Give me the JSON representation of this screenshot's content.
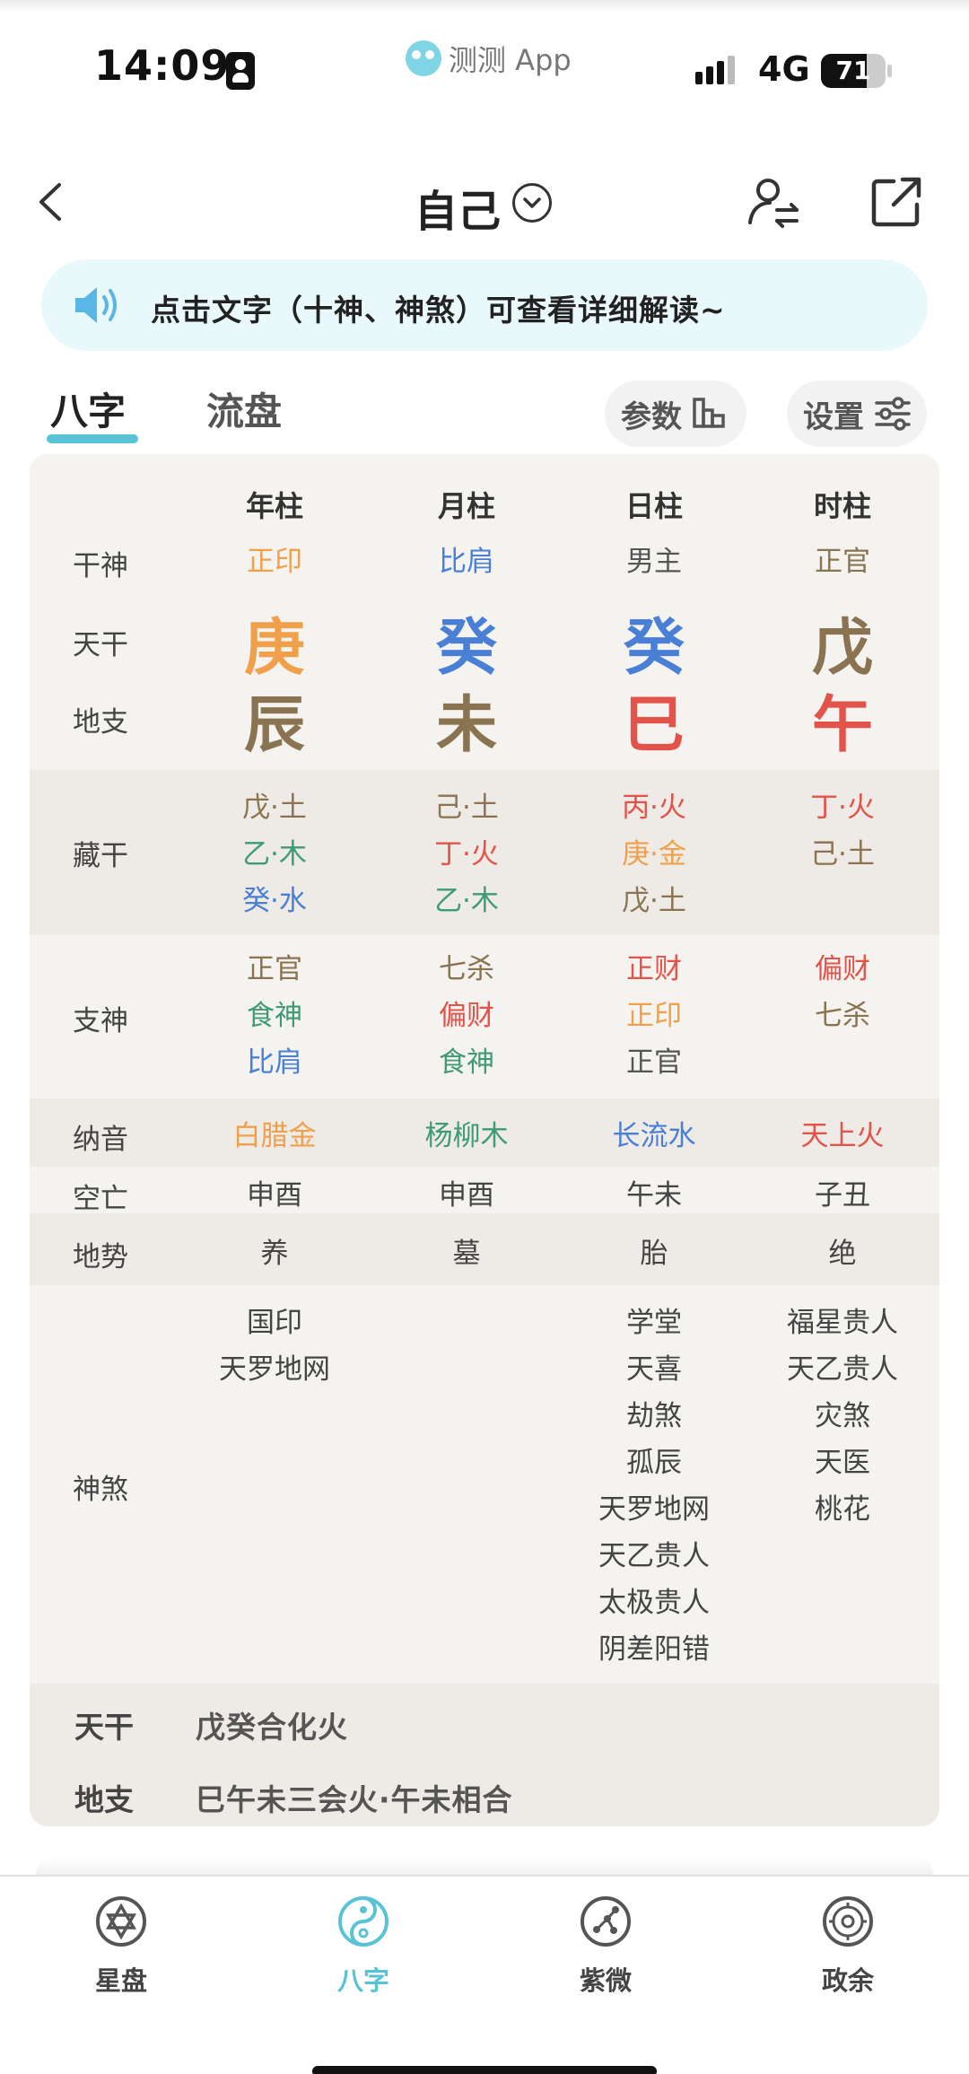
{
  "status_bar": {
    "time": "14:09",
    "app_label": "测测 App",
    "network": "4G",
    "battery": "71",
    "battery_level": 0.71
  },
  "header": {
    "title": "自己"
  },
  "tip": "点击文字（十神、神煞）可查看详细解读~",
  "tabs": [
    {
      "label": "八字",
      "active": true
    },
    {
      "label": "流盘",
      "active": false
    }
  ],
  "actions": {
    "params_label": "参数",
    "settings_label": "设置"
  },
  "colors": {
    "brown": "#8a7350",
    "orange": "#f0a04a",
    "blue": "#4a7fd6",
    "green": "#3e9b74",
    "red": "#e2534a",
    "gray": "#555555",
    "accent": "#59c3d6"
  },
  "chart": {
    "row_labels": {
      "shishen": "干神",
      "tiangan": "天干",
      "dizhi": "地支",
      "canggan": "藏干",
      "zhishen": "支神",
      "nayin": "纳音",
      "kongwang": "空亡",
      "dishi": "地势",
      "shensha": "神煞"
    },
    "columns": [
      {
        "header": "年柱",
        "shishen": "正印",
        "tiangan": "庚",
        "dizhi": "辰",
        "canggan": [
          "戊·土",
          "乙·木",
          "癸·水"
        ],
        "zhishen": [
          "正官",
          "食神",
          "比肩"
        ],
        "nayin": "白腊金",
        "kongwang": "申酉",
        "dishi": "养",
        "shensha": [
          "国印",
          "天罗地网"
        ]
      },
      {
        "header": "月柱",
        "shishen": "比肩",
        "tiangan": "癸",
        "dizhi": "未",
        "canggan": [
          "己·土",
          "丁·火",
          "乙·木"
        ],
        "zhishen": [
          "七杀",
          "偏财",
          "食神"
        ],
        "nayin": "杨柳木",
        "kongwang": "申酉",
        "dishi": "墓",
        "shensha": []
      },
      {
        "header": "日柱",
        "shishen": "男主",
        "tiangan": "癸",
        "dizhi": "巳",
        "canggan": [
          "丙·火",
          "庚·金",
          "戊·土"
        ],
        "zhishen": [
          "正财",
          "正印",
          "正官"
        ],
        "nayin": "长流水",
        "kongwang": "午未",
        "dishi": "胎",
        "shensha": [
          "学堂",
          "天喜",
          "劫煞",
          "孤辰",
          "天罗地网",
          "天乙贵人",
          "太极贵人",
          "阴差阳错"
        ]
      },
      {
        "header": "时柱",
        "shishen": "正官",
        "tiangan": "戊",
        "dizhi": "午",
        "canggan": [
          "丁·火",
          "己·土"
        ],
        "zhishen": [
          "偏财",
          "七杀"
        ],
        "nayin": "天上火",
        "kongwang": "子丑",
        "dishi": "绝",
        "shensha": [
          "福星贵人",
          "天乙贵人",
          "灾煞",
          "天医",
          "桃花"
        ]
      }
    ]
  },
  "summary": {
    "tiangan_label": "天干",
    "tiangan_value": "戊癸合化火",
    "dizhi_label": "地支",
    "dizhi_value": "巳午未三会火·午未相合"
  },
  "bottom_nav": [
    {
      "label": "星盘",
      "icon": "star-of-david-icon",
      "active": false
    },
    {
      "label": "八字",
      "icon": "yin-yang-icon",
      "active": true
    },
    {
      "label": "紫微",
      "icon": "constellation-icon",
      "active": false
    },
    {
      "label": "政余",
      "icon": "compass-icon",
      "active": false
    }
  ]
}
